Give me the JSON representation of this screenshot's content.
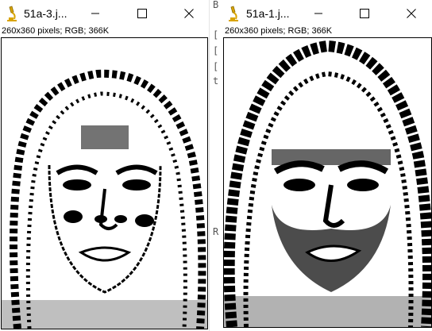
{
  "windows": [
    {
      "title": "51a-3.j...",
      "info": "260x360 pixels; RGB; 366K",
      "icons": {
        "app": "microscope-icon",
        "minimize": "minimize-icon",
        "maximize": "maximize-icon",
        "close": "close-icon"
      }
    },
    {
      "title": "51a-1.j...",
      "info": "260x360 pixels; RGB; 366K",
      "icons": {
        "app": "microscope-icon",
        "minimize": "minimize-icon",
        "maximize": "maximize-icon",
        "close": "close-icon"
      }
    }
  ],
  "background_fragments": [
    "B",
    "[",
    "[",
    "[",
    "t",
    "R"
  ],
  "colors": {
    "icon_yellow": "#d9a400",
    "icon_dark": "#8a6a00"
  }
}
